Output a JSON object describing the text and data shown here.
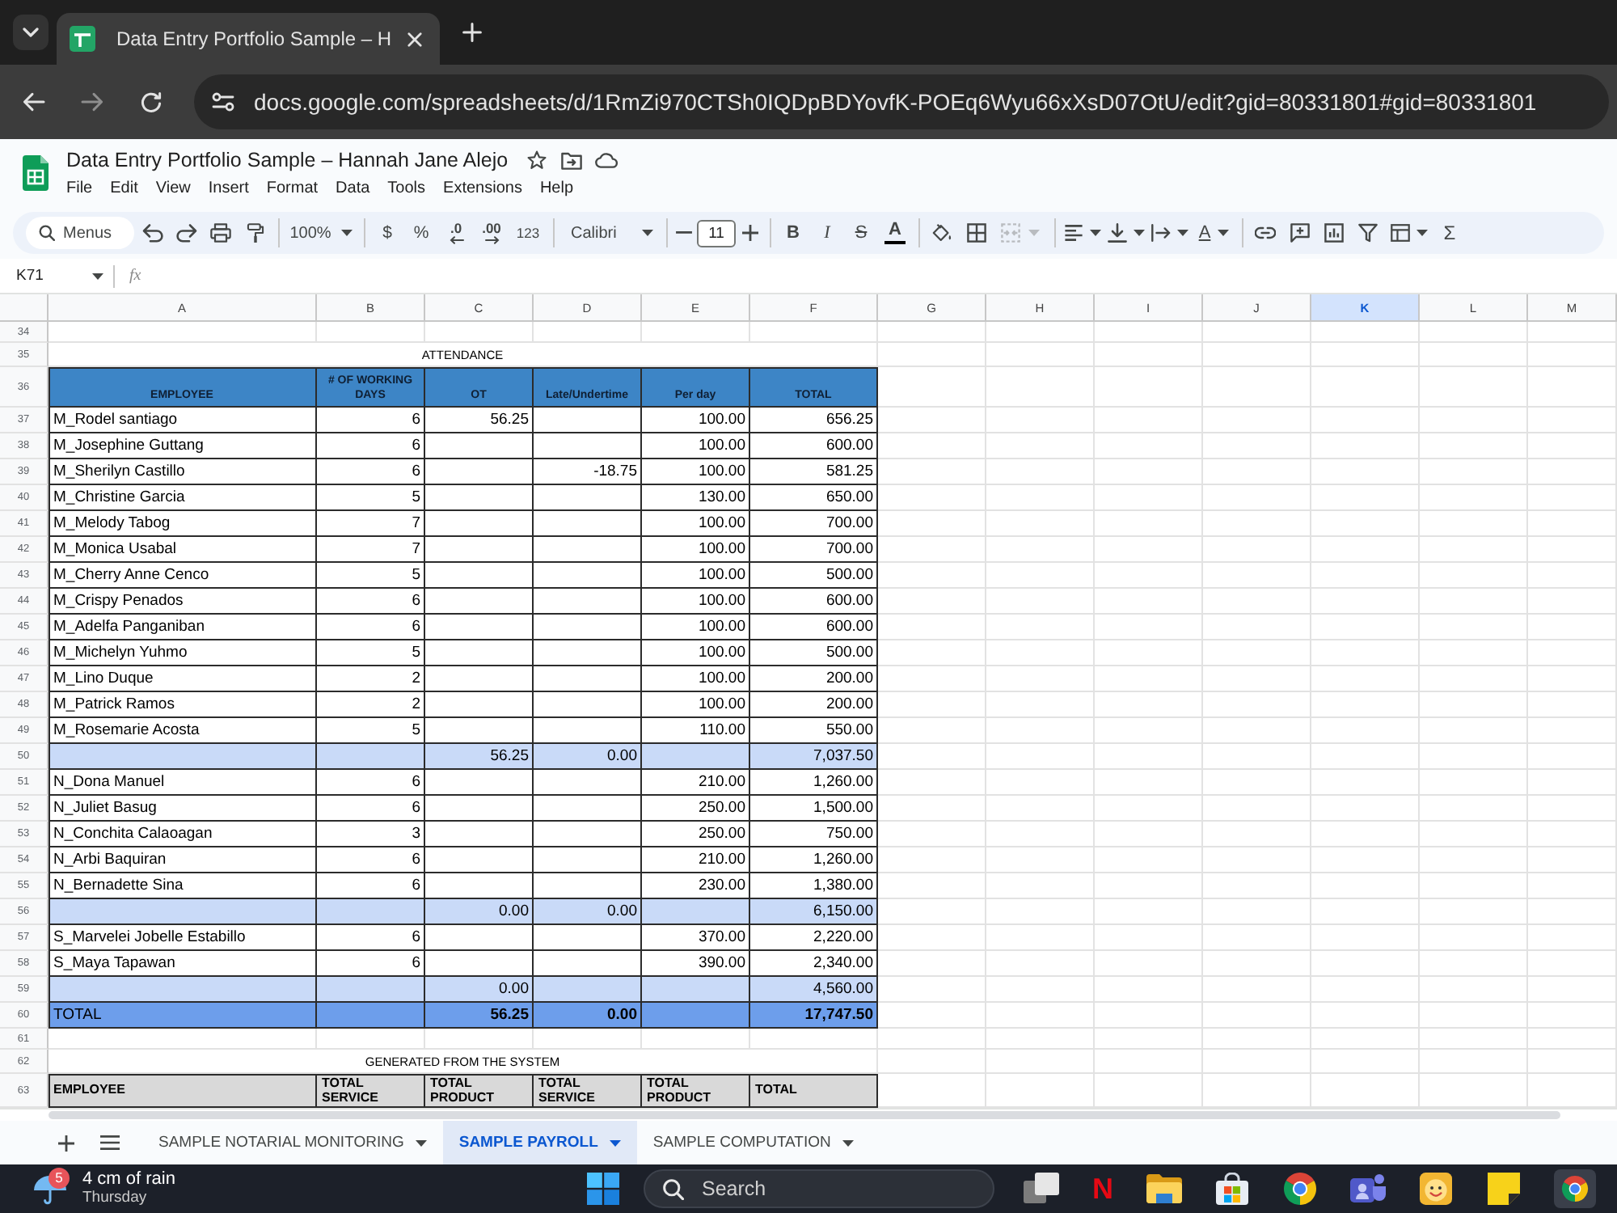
{
  "browser": {
    "tab_title": "Data Entry Portfolio Sample – H",
    "url": "docs.google.com/spreadsheets/d/1RmZi970CTSh0IQDpBDYovfK-POEq6Wyu66xXsD07OtU/edit?gid=80331801#gid=80331801"
  },
  "document": {
    "title": "Data Entry Portfolio Sample – Hannah Jane Alejo",
    "menu": [
      "File",
      "Edit",
      "View",
      "Insert",
      "Format",
      "Data",
      "Tools",
      "Extensions",
      "Help"
    ]
  },
  "toolbar": {
    "menu_search": {
      "placeholder": "Menus"
    },
    "zoom": "100%",
    "currency": "$",
    "percent": "%",
    "decrease_decimal": ".0",
    "increase_decimal": ".00",
    "number_format": "123",
    "font": "Calibri",
    "font_size": "11",
    "bold": "B",
    "italic": "I",
    "strikethrough": "S",
    "text_color": "A",
    "text_rotation": "A",
    "merge_cells": {
      "disabled": true
    },
    "functions": "Σ"
  },
  "formula_bar": {
    "name_box": "K71",
    "fx": "fx"
  },
  "columns": [
    {
      "label": "A",
      "selected": false
    },
    {
      "label": "B",
      "selected": false
    },
    {
      "label": "C",
      "selected": false
    },
    {
      "label": "D",
      "selected": false
    },
    {
      "label": "E",
      "selected": false
    },
    {
      "label": "F",
      "selected": false
    },
    {
      "label": "G",
      "selected": false
    },
    {
      "label": "H",
      "selected": false
    },
    {
      "label": "I",
      "selected": false
    },
    {
      "label": "J",
      "selected": false
    },
    {
      "label": "K",
      "selected": true
    },
    {
      "label": "L",
      "selected": false
    },
    {
      "label": "M",
      "selected": false
    }
  ],
  "sheet": {
    "rows": [
      {
        "number": "34",
        "kind": "blank"
      },
      {
        "number": "35",
        "kind": "title",
        "text": "ATTENDANCE"
      },
      {
        "number": "36",
        "kind": "header",
        "cells": [
          "EMPLOYEE",
          "# OF WORKING DAYS",
          "OT",
          "Late/Undertime",
          "Per day",
          "TOTAL"
        ]
      },
      {
        "number": "37",
        "kind": "data",
        "employee": "M_Rodel santiago",
        "working_days": "6",
        "ot": "56.25",
        "per_day": "100.00",
        "total": "656.25"
      },
      {
        "number": "38",
        "kind": "data",
        "employee": "M_Josephine Guttang",
        "working_days": "6",
        "per_day": "100.00",
        "total": "600.00"
      },
      {
        "number": "39",
        "kind": "data",
        "employee": "M_Sherilyn Castillo",
        "working_days": "6",
        "late_undertime": "-18.75",
        "per_day": "100.00",
        "total": "581.25"
      },
      {
        "number": "40",
        "kind": "data",
        "employee": "M_Christine Garcia",
        "working_days": "5",
        "per_day": "130.00",
        "total": "650.00"
      },
      {
        "number": "41",
        "kind": "data",
        "employee": "M_Melody Tabog",
        "working_days": "7",
        "per_day": "100.00",
        "total": "700.00"
      },
      {
        "number": "42",
        "kind": "data",
        "employee": "M_Monica Usabal",
        "working_days": "7",
        "per_day": "100.00",
        "total": "700.00"
      },
      {
        "number": "43",
        "kind": "data",
        "employee": "M_Cherry Anne Cenco",
        "working_days": "5",
        "per_day": "100.00",
        "total": "500.00"
      },
      {
        "number": "44",
        "kind": "data",
        "employee": "M_Crispy Penados",
        "working_days": "6",
        "per_day": "100.00",
        "total": "600.00"
      },
      {
        "number": "45",
        "kind": "data",
        "employee": "M_Adelfa Panganiban",
        "working_days": "6",
        "per_day": "100.00",
        "total": "600.00"
      },
      {
        "number": "46",
        "kind": "data",
        "employee": "M_Michelyn Yuhmo",
        "working_days": "5",
        "per_day": "100.00",
        "total": "500.00"
      },
      {
        "number": "47",
        "kind": "data",
        "employee": "M_Lino Duque",
        "working_days": "2",
        "per_day": "100.00",
        "total": "200.00"
      },
      {
        "number": "48",
        "kind": "data",
        "employee": "M_Patrick Ramos",
        "working_days": "2",
        "per_day": "100.00",
        "total": "200.00"
      },
      {
        "number": "49",
        "kind": "data",
        "employee": "M_Rosemarie Acosta",
        "working_days": "5",
        "per_day": "110.00",
        "total": "550.00"
      },
      {
        "number": "50",
        "kind": "subtotal",
        "ot": "56.25",
        "late_undertime": "0.00",
        "total": "7,037.50"
      },
      {
        "number": "51",
        "kind": "data",
        "employee": "N_Dona Manuel",
        "working_days": "6",
        "per_day": "210.00",
        "total": "1,260.00"
      },
      {
        "number": "52",
        "kind": "data",
        "employee": "N_Juliet Basug",
        "working_days": "6",
        "per_day": "250.00",
        "total": "1,500.00"
      },
      {
        "number": "53",
        "kind": "data",
        "employee": "N_Conchita Calaoagan",
        "working_days": "3",
        "per_day": "250.00",
        "total": "750.00"
      },
      {
        "number": "54",
        "kind": "data",
        "employee": "N_Arbi Baquiran",
        "working_days": "6",
        "per_day": "210.00",
        "total": "1,260.00"
      },
      {
        "number": "55",
        "kind": "data",
        "employee": "N_Bernadette Sina",
        "working_days": "6",
        "per_day": "230.00",
        "total": "1,380.00"
      },
      {
        "number": "56",
        "kind": "subtotal",
        "ot": "0.00",
        "late_undertime": "0.00",
        "total": "6,150.00"
      },
      {
        "number": "57",
        "kind": "data",
        "employee": "S_Marvelei Jobelle Estabillo",
        "working_days": "6",
        "per_day": "370.00",
        "total": "2,220.00"
      },
      {
        "number": "58",
        "kind": "data",
        "employee": "S_Maya Tapawan",
        "working_days": "6",
        "per_day": "390.00",
        "total": "2,340.00"
      },
      {
        "number": "59",
        "kind": "subtotal",
        "ot": "0.00",
        "total": "4,560.00"
      },
      {
        "number": "60",
        "kind": "total",
        "employee": "TOTAL",
        "ot": "56.25",
        "late_undertime": "0.00",
        "total": "17,747.50"
      },
      {
        "number": "61",
        "kind": "blank"
      },
      {
        "number": "62",
        "kind": "title",
        "text": "GENERATED FROM THE SYSTEM"
      },
      {
        "number": "63",
        "kind": "system_header",
        "cells": [
          "EMPLOYEE",
          "TOTAL SERVICE",
          "TOTAL PRODUCT",
          "TOTAL SERVICE",
          "TOTAL PRODUCT",
          "TOTAL"
        ]
      }
    ]
  },
  "sheet_tabs": [
    {
      "label": "SAMPLE NOTARIAL MONITORING",
      "selected": false
    },
    {
      "label": "SAMPLE PAYROLL",
      "selected": true
    },
    {
      "label": "SAMPLE COMPUTATION",
      "selected": false
    }
  ],
  "taskbar": {
    "weather": {
      "badge": "5",
      "summary": "4 cm of rain",
      "day": "Thursday"
    },
    "search": {
      "placeholder": "Search"
    },
    "letter_app": "N"
  }
}
